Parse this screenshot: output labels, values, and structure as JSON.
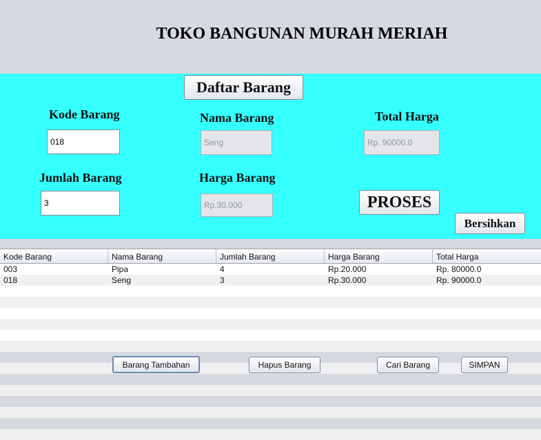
{
  "header": {
    "title": "TOKO BANGUNAN MURAH MERIAH"
  },
  "form": {
    "daftar_button": "Daftar Barang",
    "kode_label": "Kode Barang",
    "kode_value": "018",
    "nama_label": "Nama Barang",
    "nama_value": "Seng",
    "total_label": "Total Harga",
    "total_value": "Rp. 90000.0",
    "jumlah_label": "Jumlah Barang",
    "jumlah_value": "3",
    "harga_label": "Harga Barang",
    "harga_value": "Rp.30.000",
    "proses_button": "PROSES",
    "bersihkan_button": "Bersihkan"
  },
  "table": {
    "columns": [
      "Kode Barang",
      "Nama Barang",
      "Jumlah Barang",
      "Harga Barang",
      "Total Harga"
    ],
    "rows": [
      [
        "003",
        "Pipa",
        "4",
        "Rp.20.000",
        "Rp. 80000.0"
      ],
      [
        "018",
        "Seng",
        "3",
        "Rp.30.000",
        "Rp. 90000.0"
      ],
      [
        "",
        "",
        "",
        "",
        ""
      ],
      [
        "",
        "",
        "",
        "",
        ""
      ],
      [
        "",
        "",
        "",
        "",
        ""
      ],
      [
        "",
        "",
        "",
        "",
        ""
      ],
      [
        "",
        "",
        "",
        "",
        ""
      ],
      [
        "",
        "",
        "",
        "",
        ""
      ],
      [
        "",
        "",
        "",
        "",
        ""
      ],
      [
        "",
        "",
        "",
        "",
        ""
      ],
      [
        "",
        "",
        "",
        "",
        ""
      ],
      [
        "",
        "",
        "",
        "",
        ""
      ],
      [
        "",
        "",
        "",
        "",
        ""
      ],
      [
        "",
        "",
        "",
        "",
        ""
      ],
      [
        "",
        "",
        "",
        "",
        ""
      ],
      [
        "",
        "",
        "",
        "",
        ""
      ]
    ]
  },
  "actions": {
    "tambah": "Barang Tambahan",
    "hapus": "Hapus Barang",
    "cari": "Cari Barang",
    "simpan": "SIMPAN"
  }
}
